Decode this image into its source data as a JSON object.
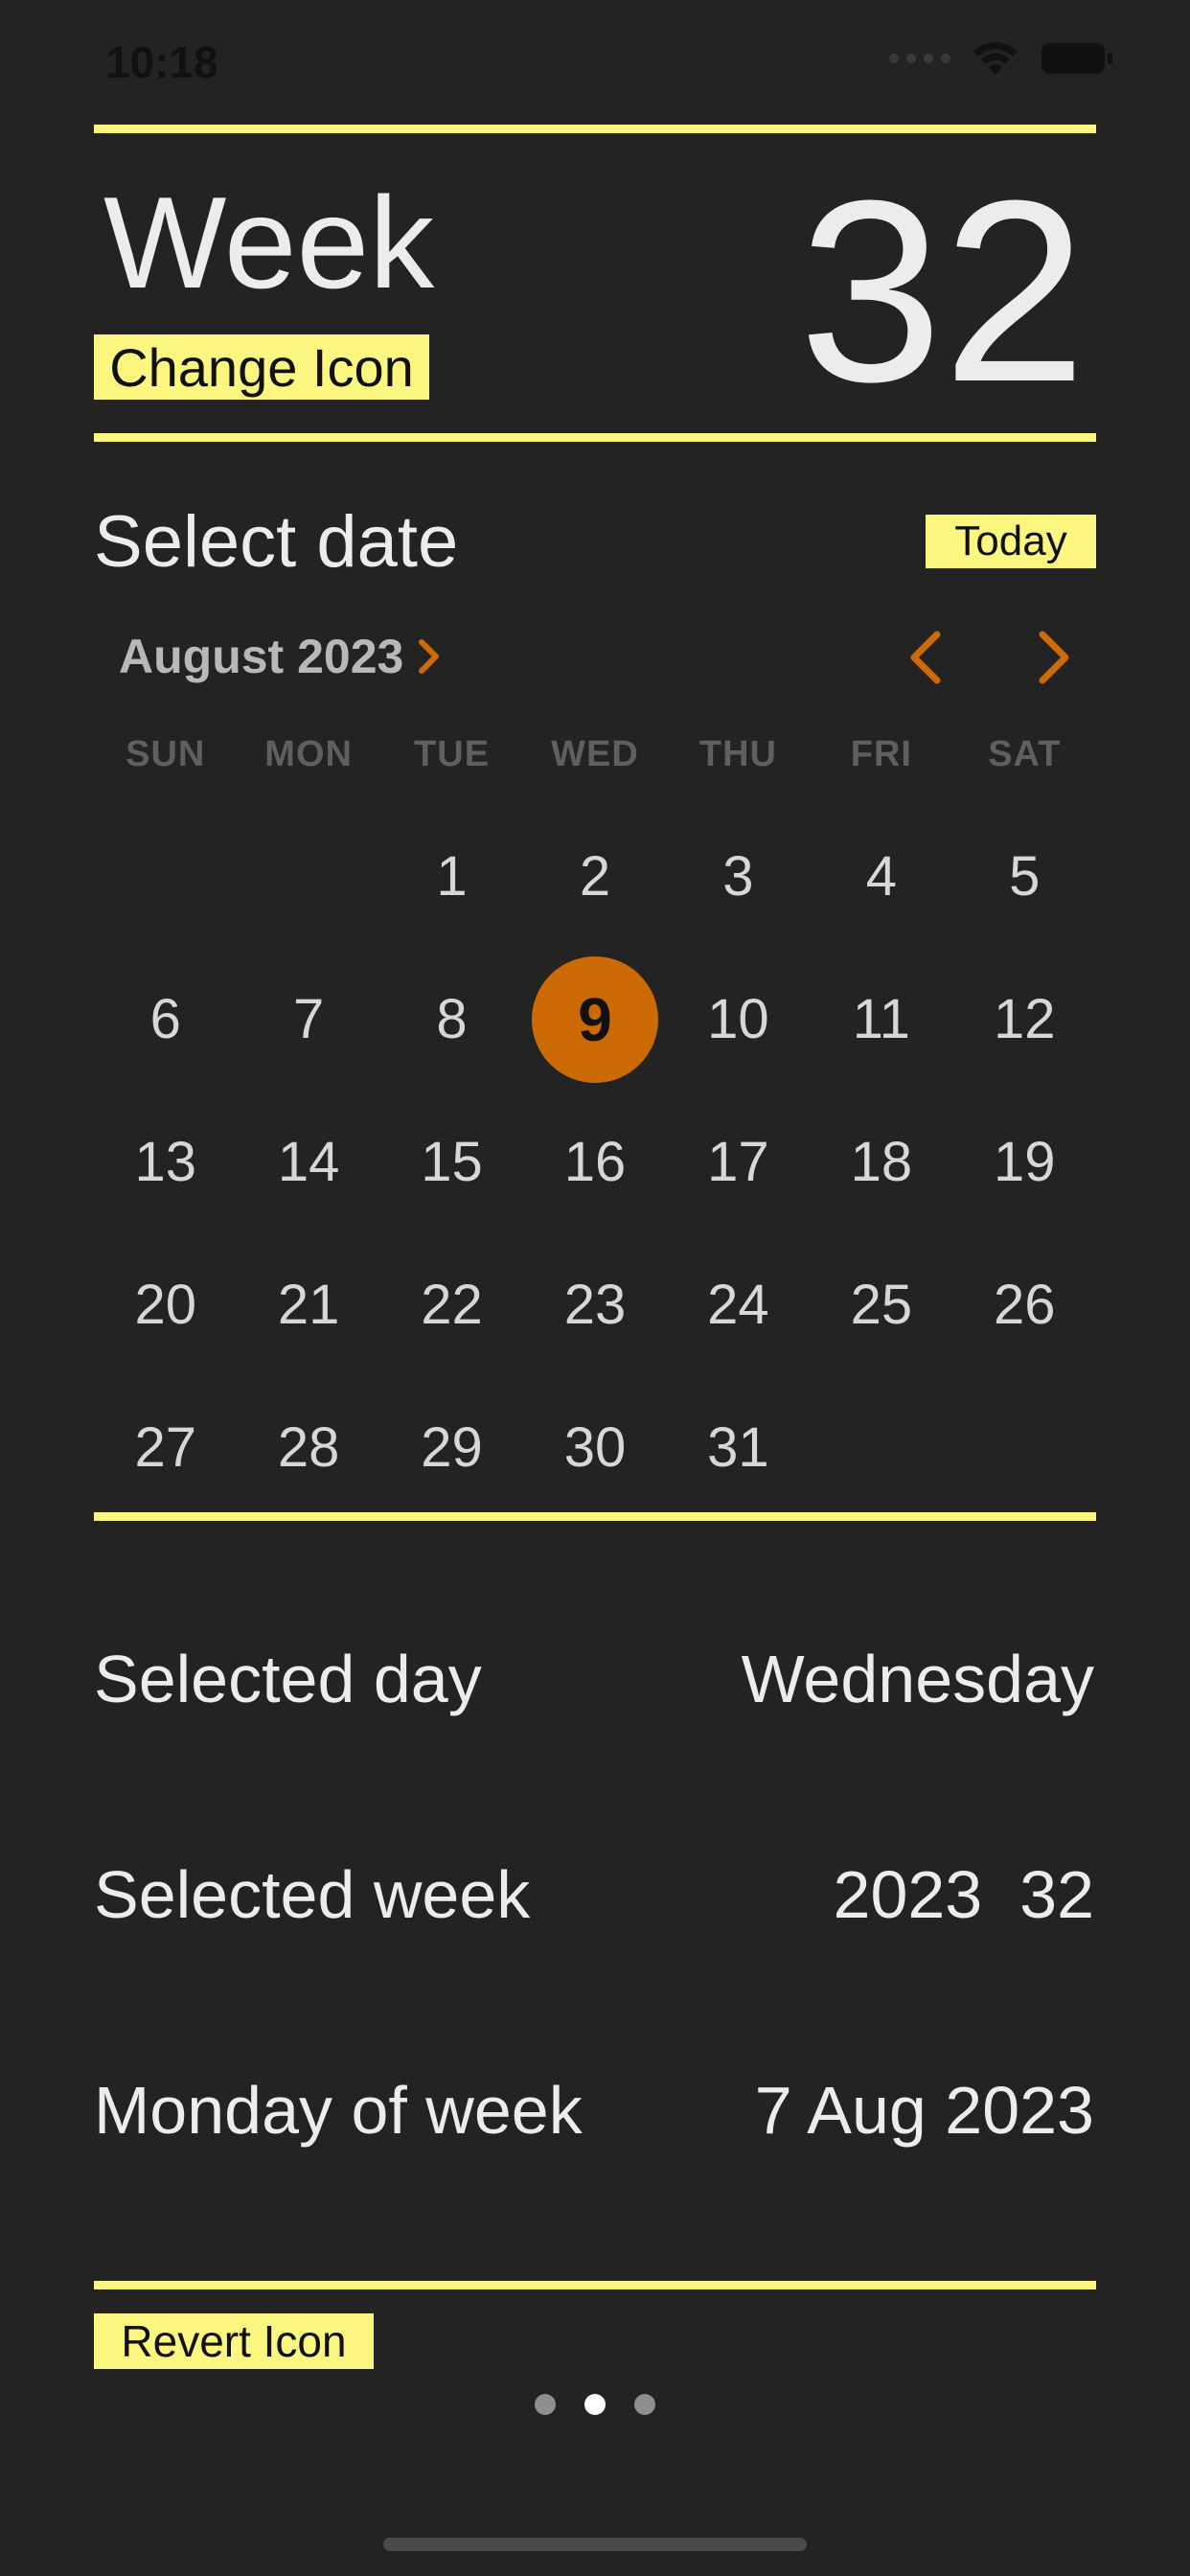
{
  "status_bar": {
    "time": "10:18"
  },
  "header": {
    "title": "Week",
    "week_number": "32",
    "change_icon_label": "Change Icon"
  },
  "calendar": {
    "section_title": "Select date",
    "today_label": "Today",
    "month_label": "August 2023",
    "weekdays": [
      "SUN",
      "MON",
      "TUE",
      "WED",
      "THU",
      "FRI",
      "SAT"
    ],
    "days": [
      "",
      "",
      "1",
      "2",
      "3",
      "4",
      "5",
      "6",
      "7",
      "8",
      "9",
      "10",
      "11",
      "12",
      "13",
      "14",
      "15",
      "16",
      "17",
      "18",
      "19",
      "20",
      "21",
      "22",
      "23",
      "24",
      "25",
      "26",
      "27",
      "28",
      "29",
      "30",
      "31",
      "",
      ""
    ],
    "selected_day": "9",
    "accent_color": "#cc6a06"
  },
  "info": {
    "selected_day_label": "Selected day",
    "selected_day_value": "Wednesday",
    "selected_week_label": "Selected week",
    "selected_week_value": "2023  32",
    "monday_label": "Monday of week",
    "monday_value": "7 Aug 2023"
  },
  "footer": {
    "revert_icon_label": "Revert Icon",
    "page_count": 3,
    "active_page": 2
  },
  "colors": {
    "background": "#232323",
    "highlight": "#fbf680",
    "accent": "#cc6a06"
  }
}
